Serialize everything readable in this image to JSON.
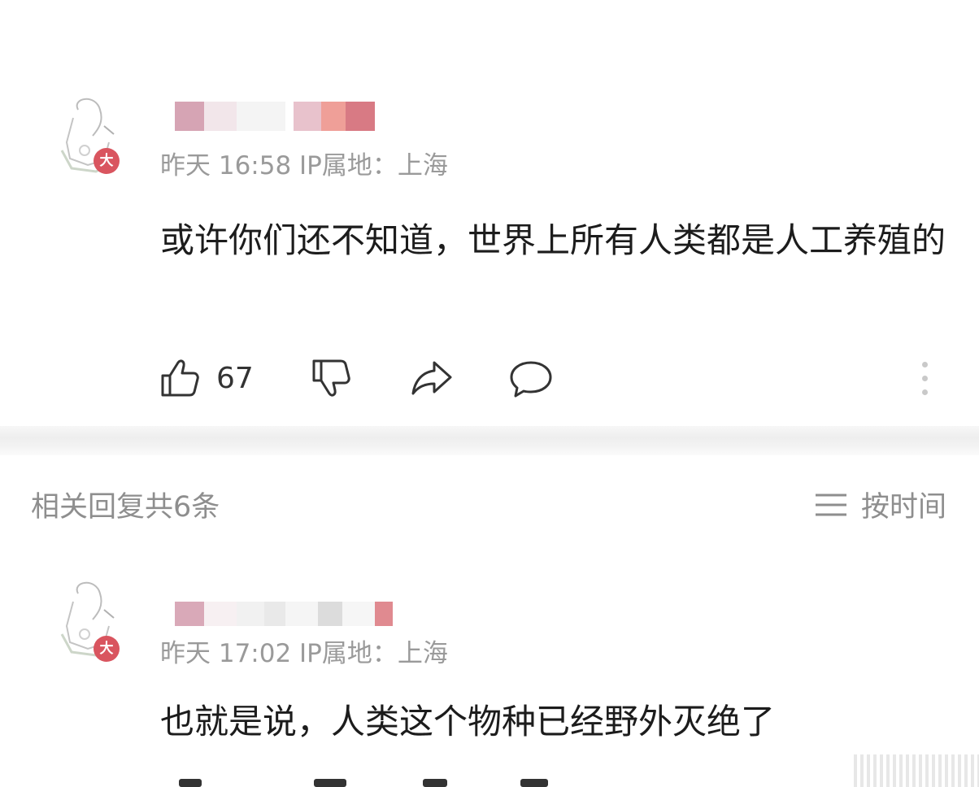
{
  "comment": {
    "meta": "昨天 16:58 IP属地：上海",
    "badge": "大",
    "text": "或许你们还不知道，世界上所有人类都是人工养殖的",
    "likes": "67",
    "icons": [
      "thumbs-up-icon",
      "thumbs-down-icon",
      "share-icon",
      "comment-icon",
      "more-icon"
    ]
  },
  "replies_header": {
    "title": "相关回复共6条",
    "sort_label": "按时间",
    "sort_icon": "list-icon"
  },
  "reply": {
    "meta": "昨天 17:02 IP属地：上海",
    "badge": "大",
    "text": "也就是说，人类这个物种已经野外灭绝了"
  },
  "colors": {
    "badge": "#d9555f",
    "meta_text": "#9a9a9a",
    "body_text": "#1c1c1c"
  }
}
